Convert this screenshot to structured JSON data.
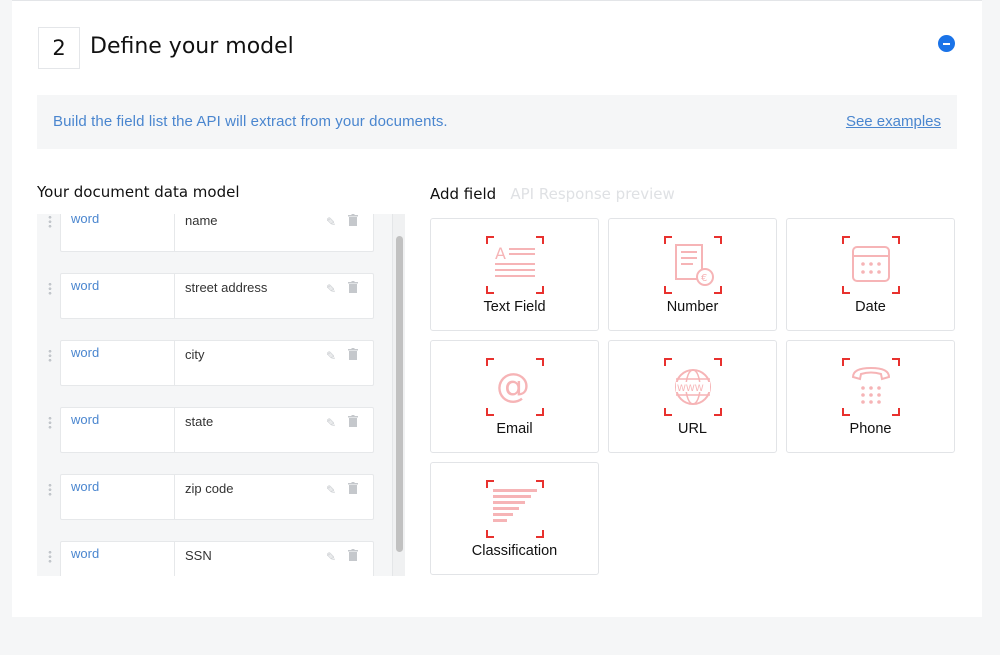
{
  "header": {
    "step_number": "2",
    "title": "Define your model"
  },
  "info_bar": {
    "text": "Build the field list the API will extract from your documents.",
    "link": "See examples"
  },
  "data_model": {
    "title": "Your document data model",
    "fields": [
      {
        "type": "word",
        "name": "name"
      },
      {
        "type": "word",
        "name": "street address"
      },
      {
        "type": "word",
        "name": "city"
      },
      {
        "type": "word",
        "name": "state"
      },
      {
        "type": "word",
        "name": "zip code"
      },
      {
        "type": "word",
        "name": "SSN"
      }
    ]
  },
  "tabs": {
    "active": "Add field",
    "inactive": "API Response preview"
  },
  "field_types": [
    {
      "label": "Text Field",
      "icon": "text-field-icon"
    },
    {
      "label": "Number",
      "icon": "number-icon"
    },
    {
      "label": "Date",
      "icon": "date-icon"
    },
    {
      "label": "Email",
      "icon": "email-icon"
    },
    {
      "label": "URL",
      "icon": "url-icon"
    },
    {
      "label": "Phone",
      "icon": "phone-icon"
    },
    {
      "label": "Classification",
      "icon": "classification-icon"
    }
  ],
  "colors": {
    "accent": "#1a73e8",
    "link": "#4a86cf",
    "icon_red": "#e8312e",
    "icon_pink": "#f6b4b6"
  }
}
